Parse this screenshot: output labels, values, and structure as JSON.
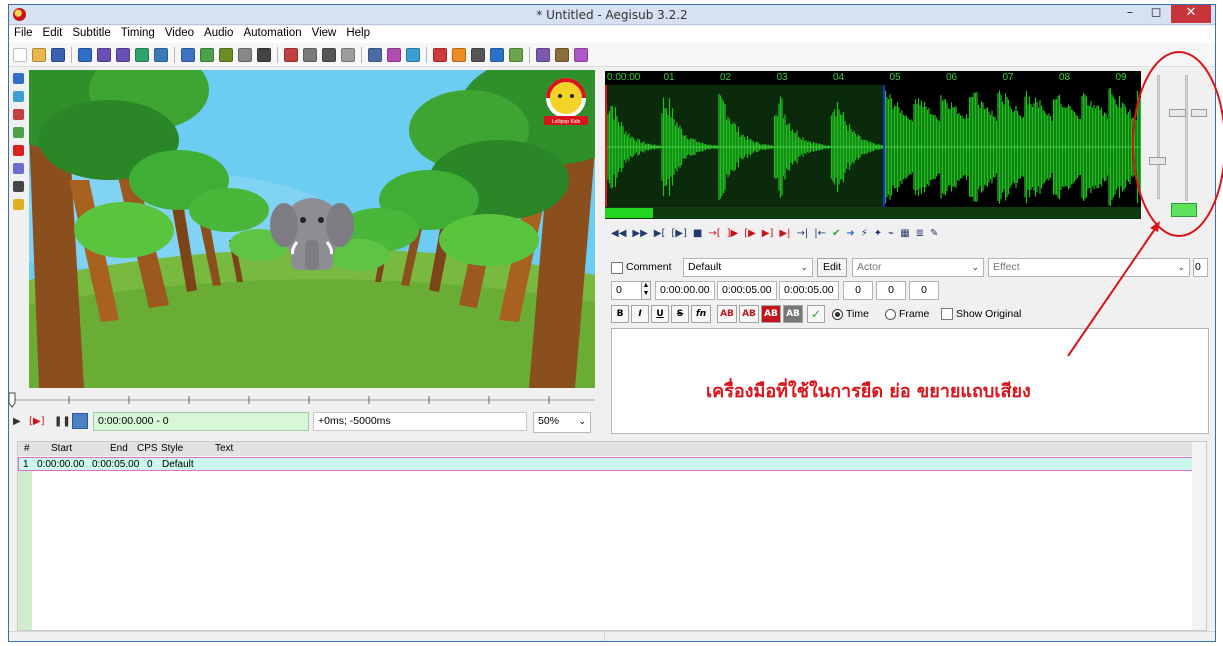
{
  "window": {
    "title": "* Untitled - Aegisub 3.2.2",
    "minimize_glyph": "–",
    "maximize_glyph": "◻",
    "close_glyph": "✕"
  },
  "menu": [
    "File",
    "Edit",
    "Subtitle",
    "Timing",
    "Video",
    "Audio",
    "Automation",
    "View",
    "Help"
  ],
  "toolbar_icons": [
    {
      "name": "new-file-icon",
      "color": "#ffffff"
    },
    {
      "name": "open-folder-icon",
      "color": "#e8b64a"
    },
    {
      "name": "save-icon",
      "color": "#3b5fb1"
    },
    {
      "name": "jump-arrow-icon",
      "color": "#2e6ec8"
    },
    {
      "name": "pipette-icon",
      "color": "#6a4fb5"
    },
    {
      "name": "pipette-2-icon",
      "color": "#6a4fb5"
    },
    {
      "name": "video-in-icon",
      "color": "#2ea56e"
    },
    {
      "name": "video-out-icon",
      "color": "#3a7bb8"
    },
    {
      "name": "flag-blue-icon",
      "color": "#3e72c4"
    },
    {
      "name": "flag-green-icon",
      "color": "#4aa14a"
    },
    {
      "name": "film-icon",
      "color": "#6b8e23"
    },
    {
      "name": "film-strip-icon",
      "color": "#888888"
    },
    {
      "name": "film-dark-icon",
      "color": "#444444"
    },
    {
      "name": "styles-icon",
      "color": "#c33f3f"
    },
    {
      "name": "properties-icon",
      "color": "#7b7b7b"
    },
    {
      "name": "attachments-icon",
      "color": "#555555"
    },
    {
      "name": "fonts-icon",
      "color": "#9c9c9c"
    },
    {
      "name": "automation-icon",
      "color": "#4c6ca8"
    },
    {
      "name": "resample-icon",
      "color": "#b04cb0"
    },
    {
      "name": "timing-icon",
      "color": "#3a9fd1"
    },
    {
      "name": "kanji-icon",
      "color": "#cf3b3b"
    },
    {
      "name": "shift-icon",
      "color": "#f08a23"
    },
    {
      "name": "stop-icon",
      "color": "#555555"
    },
    {
      "name": "clock-icon",
      "color": "#2a73c9"
    },
    {
      "name": "translate-icon",
      "color": "#6aa74c"
    },
    {
      "name": "spellcheck-icon",
      "color": "#7d5aaf"
    },
    {
      "name": "options-icon",
      "color": "#8a6d3b"
    },
    {
      "name": "help-icon",
      "color": "#b057c8"
    }
  ],
  "side_tools": [
    {
      "name": "standard-tool-icon",
      "color": "#2e6ec8"
    },
    {
      "name": "drag-tool-icon",
      "color": "#3a9fd1"
    },
    {
      "name": "rotate-z-icon",
      "color": "#c24040"
    },
    {
      "name": "rotate-xy-icon",
      "color": "#4aa14a"
    },
    {
      "name": "scale-tool-icon",
      "color": "#d82020"
    },
    {
      "name": "clip-tool-icon",
      "color": "#6b6bd0"
    },
    {
      "name": "vector-clip-icon",
      "color": "#444444"
    },
    {
      "name": "help-question-icon",
      "color": "#e0b020"
    }
  ],
  "video": {
    "channel_badge": "Lollipop Kids"
  },
  "video_controls": {
    "play_glyph": "▶",
    "play_line_glyph": "[▶]",
    "stop_glyph": "❚❚",
    "time_value": "0:00:00.000 - 0",
    "offset_value": "+0ms; -5000ms",
    "zoom_value": "50%",
    "dropdown_glyph": "⌄"
  },
  "audio": {
    "ruler_labels": [
      "0:00:00",
      "01",
      "02",
      "03",
      "04",
      "05",
      "06",
      "07",
      "08",
      "09"
    ],
    "waveform_color": "#1fbf1f",
    "waveform_bg_selected": "#0b2a0b",
    "toolbar_glyphs": [
      "◀◀",
      "▶▶",
      "▶[",
      "[▶]",
      "■",
      "→[",
      "]▶",
      "[▶",
      "▶]",
      "▶|",
      "→|",
      "|←",
      "✔",
      "➜",
      "⚡",
      "✦",
      "⌁",
      "▦",
      "≣",
      "✎"
    ]
  },
  "editbox": {
    "comment_label": "Comment",
    "style_value": "Default",
    "edit_label": "Edit",
    "actor_placeholder": "Actor",
    "effect_placeholder": "Effect",
    "margin_value": "0",
    "layer_value": "0",
    "start_time": "0:00:00.00",
    "end_time": "0:00:05.00",
    "duration": "0:00:05.00",
    "margin_l": "0",
    "margin_r": "0",
    "margin_v": "0",
    "format_buttons": [
      {
        "label": "B",
        "name": "bold-button"
      },
      {
        "label": "I",
        "name": "italic-button"
      },
      {
        "label": "U",
        "name": "underline-button"
      },
      {
        "label": "S",
        "name": "strikeout-button"
      },
      {
        "label": "fn",
        "name": "font-button"
      },
      {
        "label": "AB",
        "name": "primary-color-button"
      },
      {
        "label": "AB",
        "name": "secondary-color-button"
      },
      {
        "label": "AB",
        "name": "outline-color-button"
      },
      {
        "label": "AB",
        "name": "shadow-color-button"
      },
      {
        "label": "✓",
        "name": "commit-button"
      }
    ],
    "time_label": "Time",
    "frame_label": "Frame",
    "show_original_label": "Show Original"
  },
  "annotation": {
    "text": "เครื่องมือที่ใช้ในการยืด ย่อ ขยายแถบเสียง",
    "color": "#d8151b"
  },
  "grid": {
    "headers": [
      "#",
      "Start",
      "End",
      "CPS",
      "Style",
      "Text"
    ],
    "rows": [
      {
        "num": "1",
        "start": "0:00:00.00",
        "end": "0:00:05.00",
        "cps": "0",
        "style": "Default",
        "text": ""
      }
    ]
  }
}
